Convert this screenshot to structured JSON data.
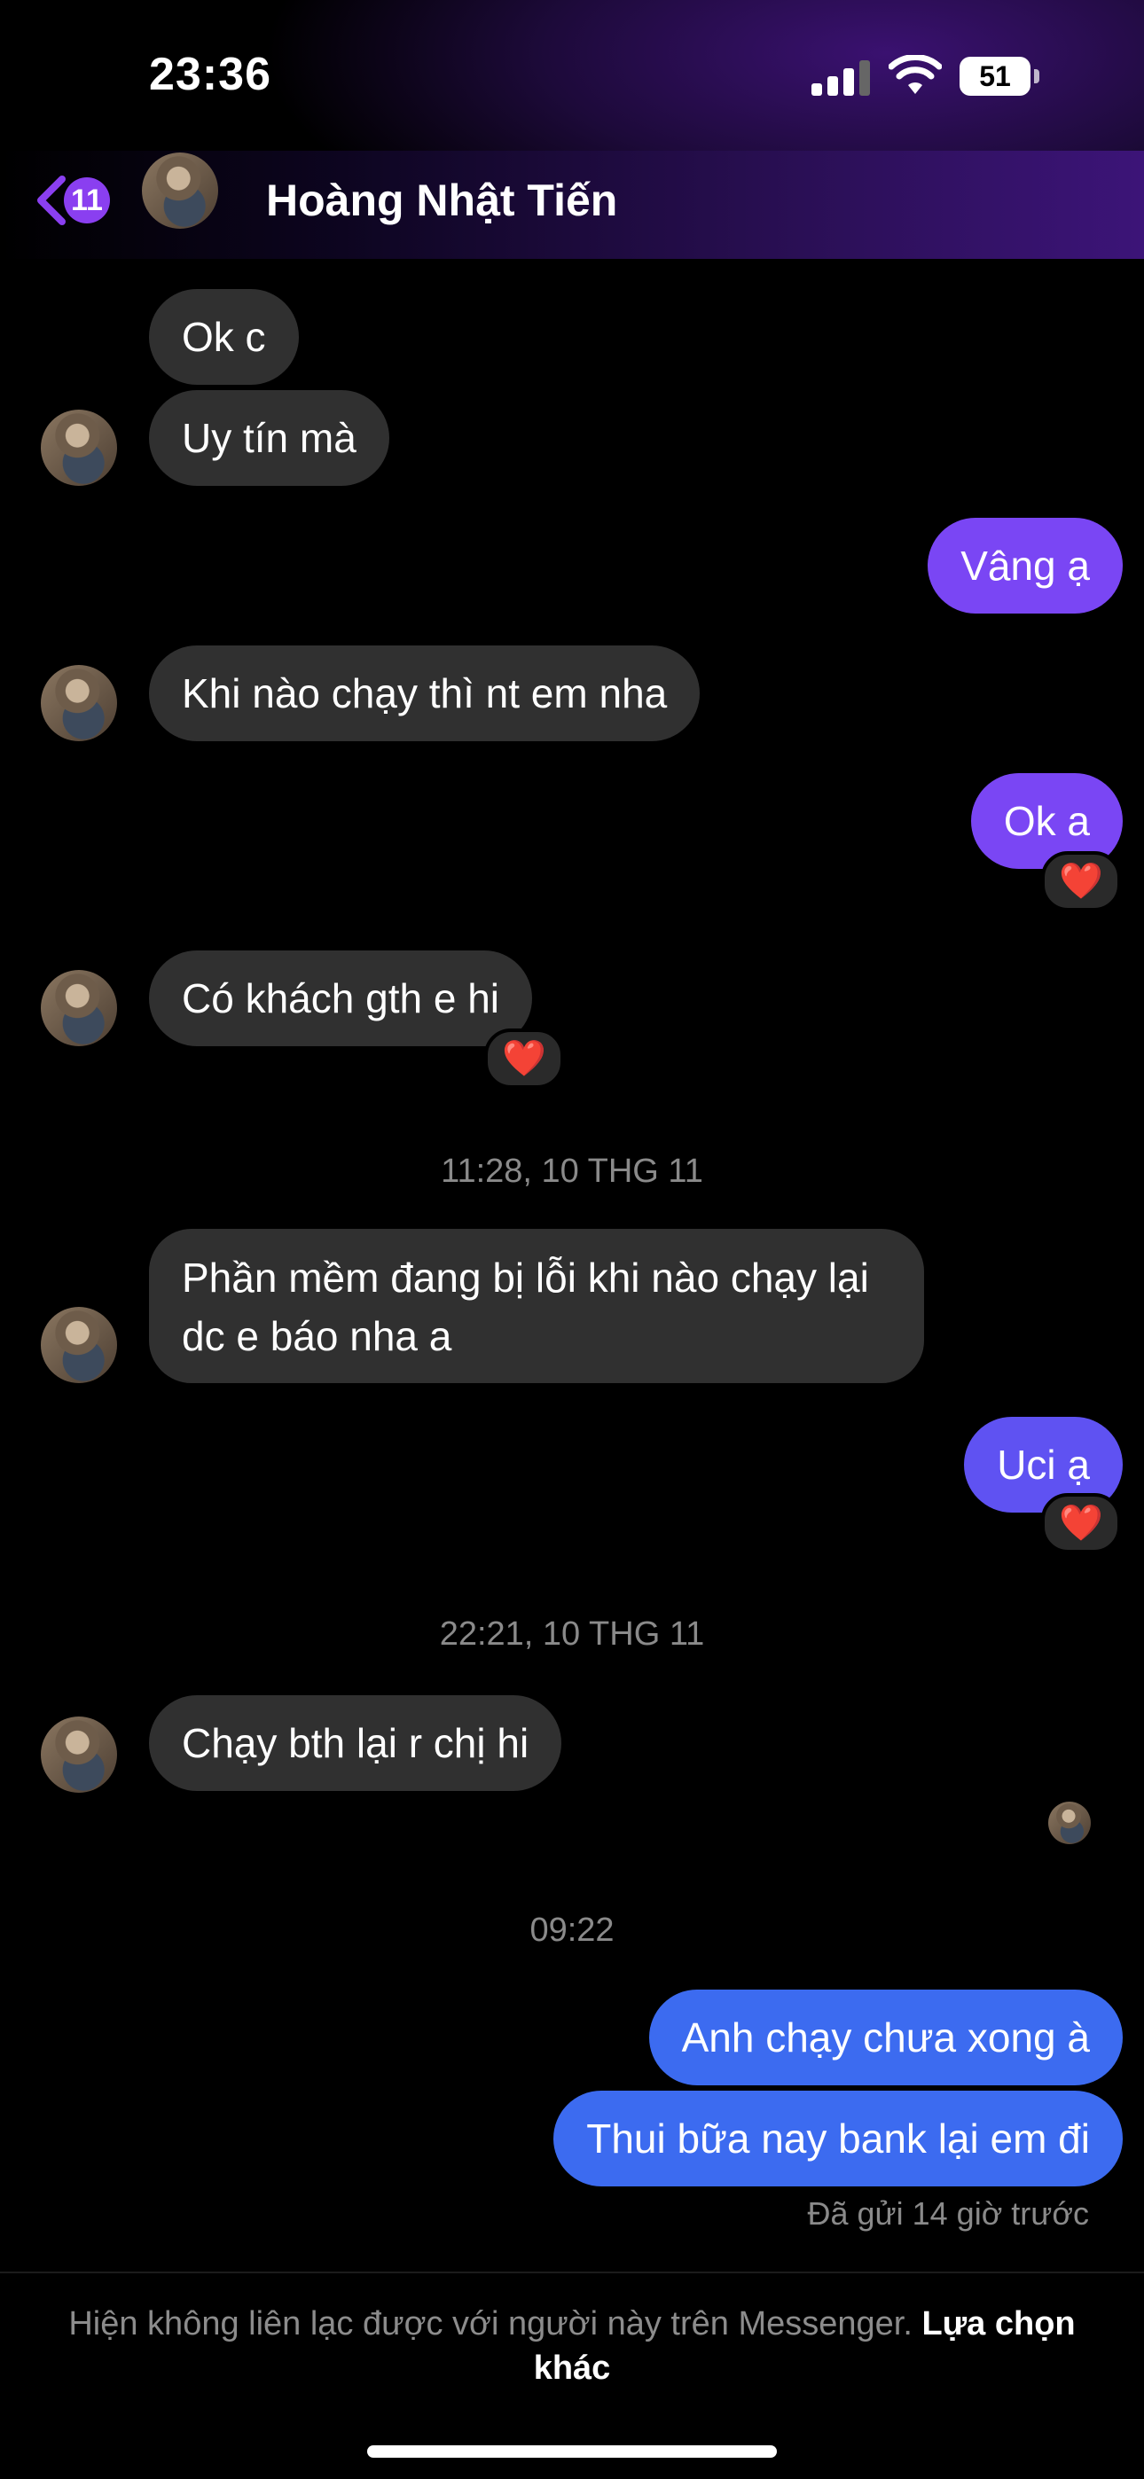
{
  "status_bar": {
    "time": "23:36",
    "battery": "51"
  },
  "header": {
    "back_badge": "11",
    "contact_name": "Hoàng Nhật Tiến"
  },
  "messages": [
    {
      "text": "Ok c"
    },
    {
      "text": "Uy tín mà"
    },
    {
      "text": "Vâng ạ"
    },
    {
      "text": "Khi nào chạy thì nt em nha"
    },
    {
      "text": "Ok a",
      "reaction": "❤️"
    },
    {
      "text": "Có khách gth e hi",
      "reaction": "❤️"
    },
    {
      "text": "Phần mềm đang bị lỗi khi nào chạy lại dc e báo nha a"
    },
    {
      "text": "Uci ạ",
      "reaction": "❤️"
    },
    {
      "text": "Chạy bth lại r chị hi"
    },
    {
      "text": "Anh chạy chưa xong à"
    },
    {
      "text": "Thui bữa nay bank lại em đi"
    }
  ],
  "timestamps": [
    "11:28, 10 THG 11",
    "22:21, 10 THG 11",
    "09:22"
  ],
  "sent_status": "Đã gửi 14 giờ trước",
  "footer": {
    "notice": "Hiện không liên lạc được với người này trên Messenger.",
    "link": "Lựa chọn khác"
  },
  "colors": {
    "outgoing_purple": "#7a46f4",
    "outgoing_blue": "#3c6bf0",
    "incoming": "#303030",
    "badge": "#8a3ff0"
  },
  "icons": [
    "back-chevron-icon",
    "cellular-signal-icon",
    "wifi-icon",
    "battery-icon",
    "heart-reaction-icon"
  ]
}
